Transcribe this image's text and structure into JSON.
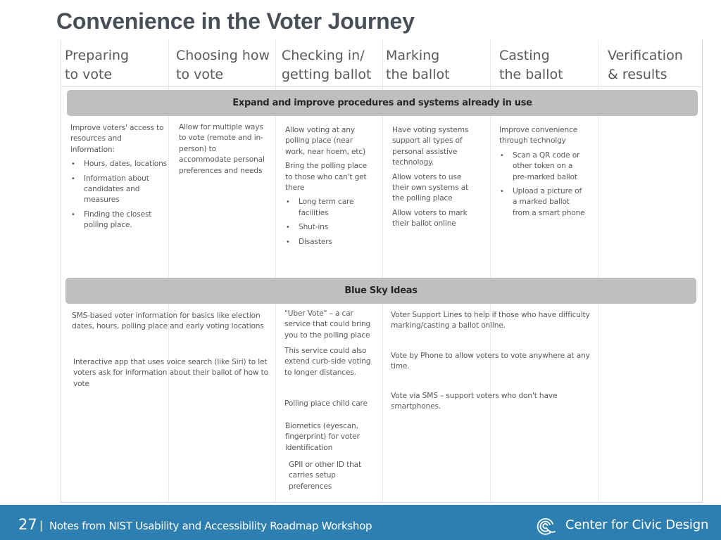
{
  "title": "Convenience in the Voter Journey",
  "columns": [
    {
      "label": "Preparing\nto vote"
    },
    {
      "label": "Choosing how\nto vote"
    },
    {
      "label": "Checking in/\ngetting ballot"
    },
    {
      "label": "Marking\nthe ballot"
    },
    {
      "label": "Casting\nthe ballot"
    },
    {
      "label": "Verification\n& results"
    }
  ],
  "section_expand": {
    "label": "Expand and improve procedures and systems already in use",
    "cells": {
      "preparing": {
        "intro": "Improve voters' access to resources and information:",
        "bullets": [
          "Hours, dates, locations",
          "Information about candidates and measures",
          "Finding the closest polling place."
        ]
      },
      "choosing": {
        "text": "Allow for multiple ways to vote (remote and in-person) to accommodate personal preferences and needs"
      },
      "checking": {
        "p1": "Allow voting at any polling place (near work, near hoem, etc)",
        "p2": "Bring the polling place to those who can't get there",
        "bullets": [
          "Long term care facilities",
          "Shut-ins",
          "Disasters"
        ]
      },
      "marking": {
        "p1": "Have voting systems support all types of personal assistive technology.",
        "p2": "Allow voters to use their own systems at the polling place",
        "p3": "Allow voters to mark their ballot online"
      },
      "casting": {
        "intro": "Improve convenience through technolgy",
        "bullets": [
          "Scan a QR code or other token on a pre-marked ballot",
          "Upload a picture of a marked ballot from a smart phone"
        ]
      }
    }
  },
  "section_bluesky": {
    "label": "Blue Sky Ideas",
    "items_left": [
      "SMS-based voter information for basics like election dates, hours, polling place and early voting locations",
      "Interactive app that uses voice search (like Siri) to let voters ask for information about their ballot of how to vote"
    ],
    "items_middle": [
      "\"Uber Vote\" – a car service that could bring you to the polling place",
      "This service could also extend curb-side voting to longer distances.",
      "Polling place child care",
      "Biometics (eyescan, fingerprint) for voter identification",
      "GPII or other ID that carries setup preferences"
    ],
    "items_right": [
      "Voter Support Lines to help if those who have difficulty marking/casting a ballot online.",
      "Vote by Phone to allow voters to vote anywhere at any time.",
      "Vote via SMS – support voters who don't have smartphones."
    ]
  },
  "footer": {
    "page_number": "27",
    "separator": "|",
    "text": "Notes from NIST Usability and Accessibility Roadmap  Workshop",
    "logo_text": "Center for Civic Design",
    "logo_icon": "civic-design-swirl-icon",
    "background_color": "#2e7fb1"
  }
}
